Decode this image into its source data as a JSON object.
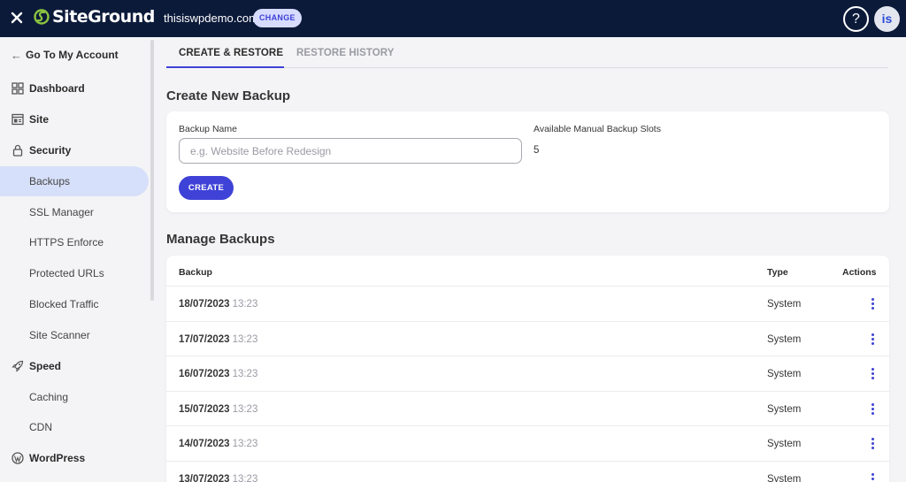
{
  "header": {
    "brand": "SiteGround",
    "domain": "thisiswpdemo.com",
    "change_label": "CHANGE",
    "help_label": "?",
    "avatar_initials": "is"
  },
  "sidebar": {
    "back_label": "Go To My Account",
    "items": [
      {
        "label": "Dashboard",
        "icon": "dashboard-icon"
      },
      {
        "label": "Site",
        "icon": "site-icon"
      },
      {
        "label": "Security",
        "icon": "lock-icon"
      },
      {
        "label": "Backups"
      },
      {
        "label": "SSL Manager"
      },
      {
        "label": "HTTPS Enforce"
      },
      {
        "label": "Protected URLs"
      },
      {
        "label": "Blocked Traffic"
      },
      {
        "label": "Site Scanner"
      },
      {
        "label": "Speed",
        "icon": "rocket-icon"
      },
      {
        "label": "Caching"
      },
      {
        "label": "CDN"
      },
      {
        "label": "WordPress",
        "icon": "wordpress-icon"
      }
    ]
  },
  "tabs": {
    "create_restore": "CREATE & RESTORE",
    "restore_history": "RESTORE HISTORY"
  },
  "create_section": {
    "title": "Create New Backup",
    "name_label": "Backup Name",
    "name_placeholder": "e.g. Website Before Redesign",
    "slots_label": "Available Manual Backup Slots",
    "slots_value": "5",
    "create_label": "CREATE"
  },
  "manage_section": {
    "title": "Manage Backups",
    "columns": {
      "backup": "Backup",
      "type": "Type",
      "actions": "Actions"
    },
    "rows": [
      {
        "date": "18/07/2023",
        "time": "13:23",
        "type": "System"
      },
      {
        "date": "17/07/2023",
        "time": "13:23",
        "type": "System"
      },
      {
        "date": "16/07/2023",
        "time": "13:23",
        "type": "System"
      },
      {
        "date": "15/07/2023",
        "time": "13:23",
        "type": "System"
      },
      {
        "date": "14/07/2023",
        "time": "13:23",
        "type": "System"
      },
      {
        "date": "13/07/2023",
        "time": "13:23",
        "type": "System"
      }
    ]
  },
  "colors": {
    "topbar": "#0c1a3a",
    "accent": "#3f42d6",
    "active_nav": "#d7e0fa",
    "logo_green": "#8bc53f"
  }
}
